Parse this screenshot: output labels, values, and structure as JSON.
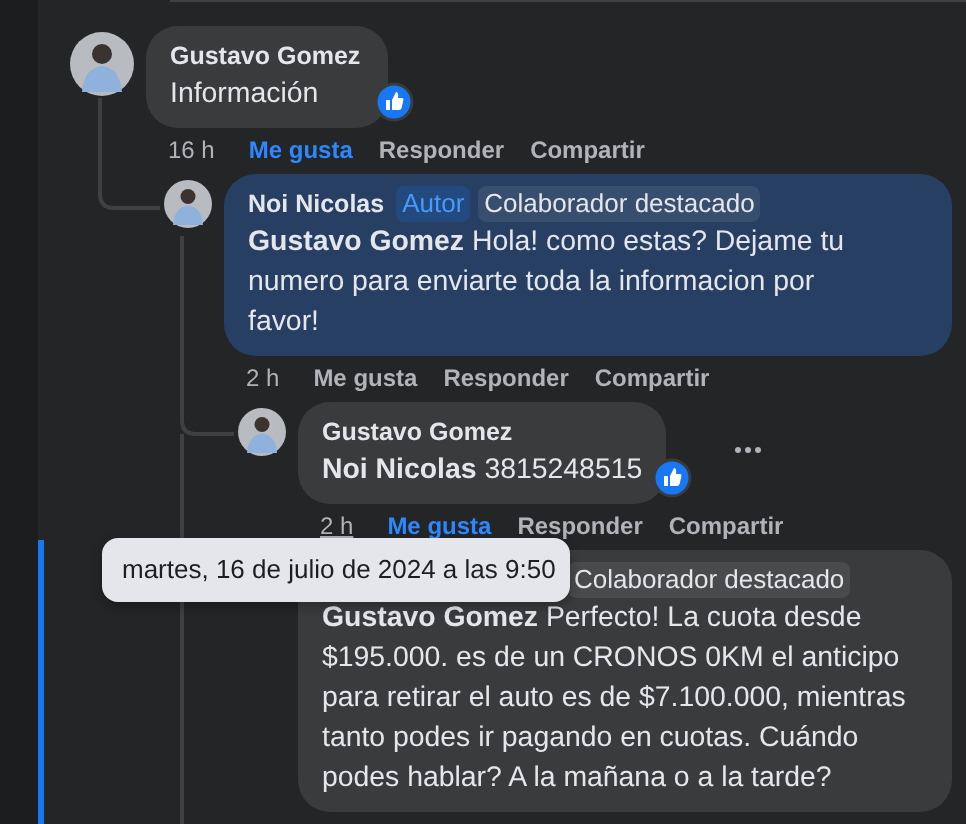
{
  "comments": [
    {
      "author": "Gustavo Gomez",
      "text": "Información",
      "reaction": true,
      "highlighted": false,
      "time": "16 h",
      "time_hovered": false,
      "liked": true,
      "actions": [
        "Me gusta",
        "Responder",
        "Compartir"
      ],
      "children": [
        {
          "author": "Noi Nicolas",
          "badges": [
            {
              "label": "Autor",
              "kind": "author"
            },
            {
              "label": "Colaborador destacado",
              "kind": "top"
            }
          ],
          "mention": "Gustavo Gomez",
          "text": "Hola! como estas? Dejame tu numero para enviarte toda la informacion por favor!",
          "reaction": false,
          "highlighted": true,
          "time": "2 h",
          "time_hovered": false,
          "liked": false,
          "actions": [
            "Me gusta",
            "Responder",
            "Compartir"
          ],
          "children": [
            {
              "author": "Gustavo Gomez",
              "mention": "Noi Nicolas",
              "text": "3815248515",
              "reaction": true,
              "highlighted": false,
              "time": "2 h",
              "time_hovered": true,
              "liked": true,
              "more_button": true,
              "actions": [
                "Me gusta",
                "Responder",
                "Compartir"
              ]
            },
            {
              "badges": [
                {
                  "label": "Colaborador destacado",
                  "kind": "top"
                }
              ],
              "mention": "Gustavo Gomez",
              "text": "Perfecto! La cuota desde $195.000. es de un CRONOS 0KM el anticipo para retirar el auto es de $7.100.000, mientras tanto podes ir pagando en cuotas. Cuándo podes hablar? A la mañana o a la tarde?",
              "reaction": false,
              "highlighted": false
            }
          ]
        }
      ]
    }
  ],
  "tooltip": "martes, 16 de julio de 2024 a las 9:50"
}
